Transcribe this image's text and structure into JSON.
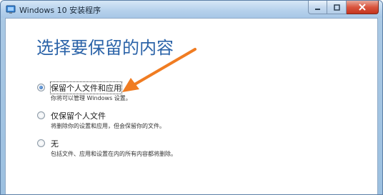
{
  "window": {
    "title": "Windows 10 安装程序"
  },
  "page": {
    "heading": "选择要保留的内容"
  },
  "options": [
    {
      "label": "保留个人文件和应用",
      "description": "你将可以管理 Windows 设置。",
      "selected": true
    },
    {
      "label": "仅保留个人文件",
      "description": "将删除你的设置和应用，但会保留你的文件。",
      "selected": false
    },
    {
      "label": "无",
      "description": "包括文件、应用和设置在内的所有内容都将删除。",
      "selected": false
    }
  ],
  "colors": {
    "heading": "#2b63a8",
    "arrow": "#f07c22",
    "close_button": "#c4341e"
  },
  "icons": {
    "title": "setup-icon",
    "arrow": "orange-arrow-annotation"
  }
}
